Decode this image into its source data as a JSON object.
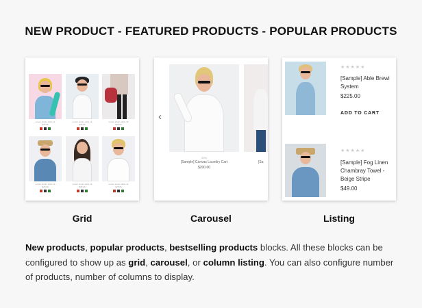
{
  "headline": "NEW PRODUCT - FEATURED PRODUCTS - POPULAR PRODUCTS",
  "panels": {
    "grid": {
      "label": "Grid",
      "tiles": [
        {
          "line1": "Lorem ipsum dolor sit",
          "line2": "$25.00"
        },
        {
          "line1": "Lorem ipsum dolor sit",
          "line2": "$25.00"
        },
        {
          "line1": "Lorem ipsum dolor sit",
          "line2": "$25.00"
        },
        {
          "line1": "Lorem ipsum dolor sit",
          "line2": "$25.00"
        },
        {
          "line1": "Lorem ipsum dolor sit",
          "line2": "$25.00"
        },
        {
          "line1": "Lorem ipsum dolor sit",
          "line2": "$25.00"
        }
      ]
    },
    "carousel": {
      "label": "Carousel",
      "arrow": "‹",
      "sold": "20%",
      "title": "[Sample] Canvas Laundry Cart",
      "price": "$200.00",
      "side_title": "[Sa"
    },
    "listing": {
      "label": "Listing",
      "items": [
        {
          "stars": "★★★★★",
          "title_line1": "[Sample] Able Brewi",
          "title_line2": "System",
          "price": "$225.00",
          "cta": "ADD TO CART"
        },
        {
          "stars": "★★★★★",
          "title_line1": "[Sample] Fog Linen",
          "title_line2": "Chambray Towel -",
          "title_line3": "Beige Stripe",
          "price": "$49.00"
        }
      ]
    }
  },
  "description": {
    "p1_b1": "New products",
    "p1_t1": ", ",
    "p1_b2": "popular products",
    "p1_t2": ", ",
    "p1_b3": "bestselling products",
    "p1_t3": " blocks. All these blocks can be configured to show up as ",
    "p1_b4": "grid",
    "p1_t4": ", ",
    "p1_b5": "carousel",
    "p1_t5": ", or ",
    "p1_b6": "column listing",
    "p1_t6": ". You can also configure number of products, number of columns to display."
  },
  "colors": {
    "swatch_red": "#c0392b",
    "swatch_dark": "#333333",
    "swatch_green": "#2e7d32"
  }
}
